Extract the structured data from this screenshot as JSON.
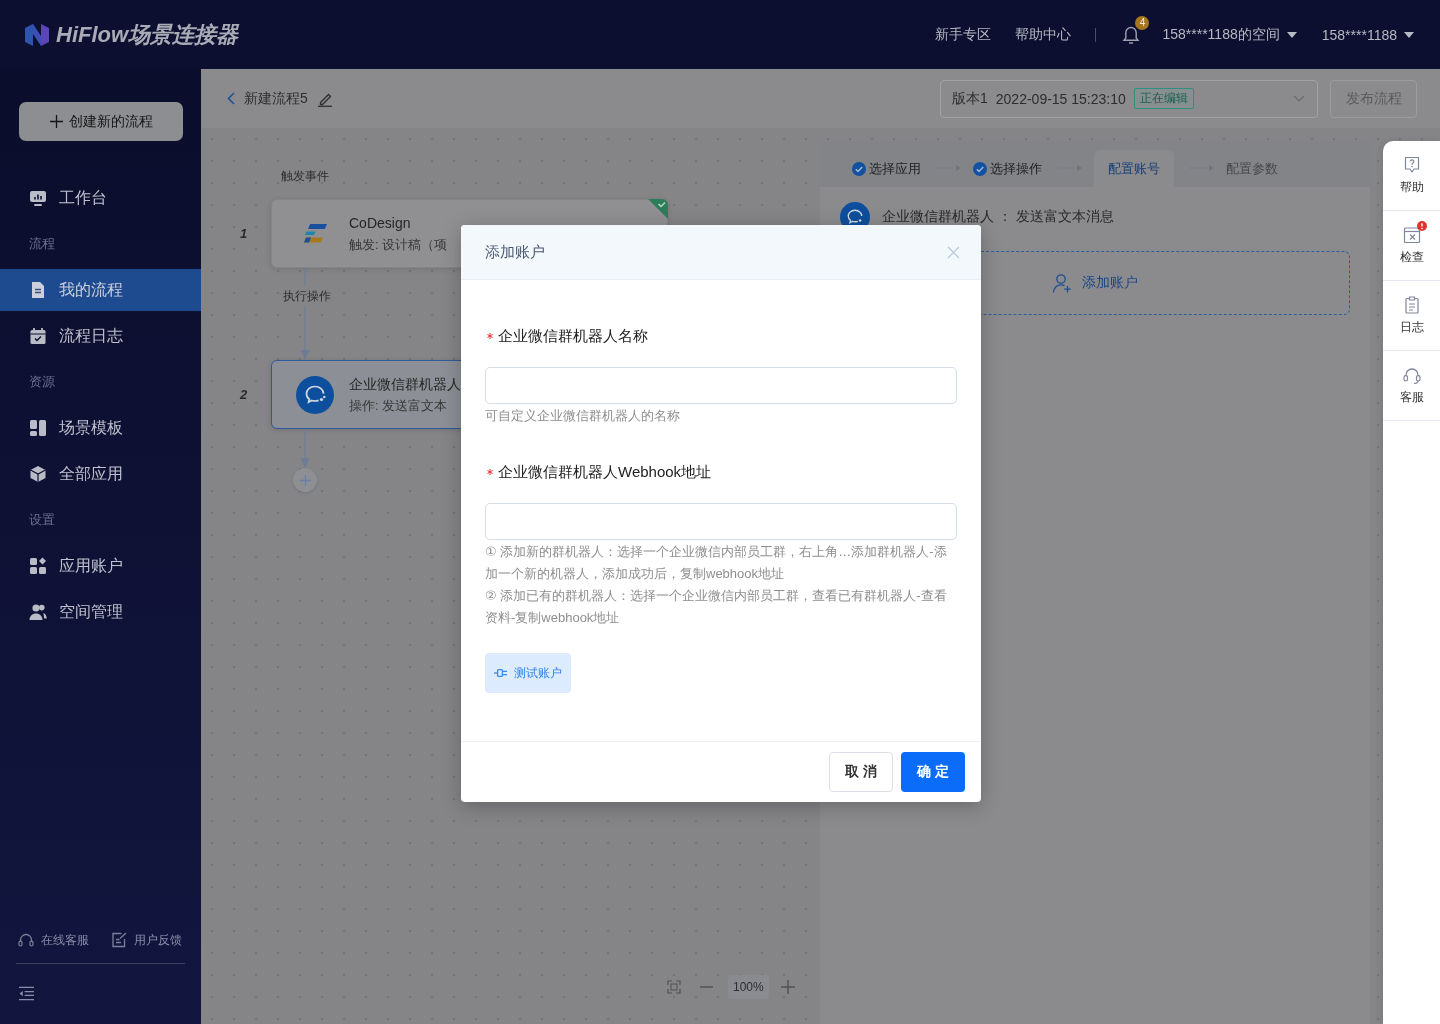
{
  "topbar": {
    "logo": "HiFlow场景连接器",
    "links": [
      "新手专区",
      "帮助中心"
    ],
    "notification_count": "4",
    "space_menu": "158****1188的空间",
    "user_menu": "158****1188"
  },
  "sidebar": {
    "create_button": "创建新的流程",
    "groups": [
      {
        "items": [
          {
            "label": "工作台",
            "selected": false
          }
        ]
      },
      {
        "title": "流程",
        "items": [
          {
            "label": "我的流程",
            "selected": true
          },
          {
            "label": "流程日志",
            "selected": false
          }
        ]
      },
      {
        "title": "资源",
        "items": [
          {
            "label": "场景模板",
            "selected": false
          },
          {
            "label": "全部应用",
            "selected": false
          }
        ]
      },
      {
        "title": "设置",
        "items": [
          {
            "label": "应用账户",
            "selected": false
          },
          {
            "label": "空间管理",
            "selected": false
          }
        ]
      }
    ],
    "footer_links": [
      "在线客服",
      "用户反馈"
    ]
  },
  "page_header": {
    "title": "新建流程5",
    "version": {
      "name": "版本1",
      "time": "2022-09-15 15:23:10",
      "tag": "正在编辑"
    },
    "publish_button": {
      "label": "发布流程",
      "disabled": true
    }
  },
  "canvas": {
    "steps": [
      {
        "number": "1",
        "label": "触发事件",
        "app": "CoDesign",
        "detail": "触发: 设计稿（项",
        "selected": false,
        "complete": true
      },
      {
        "number": "2",
        "label": "执行操作",
        "app": "企业微信群机器人",
        "detail": "操作: 发送富文本",
        "selected": true,
        "complete": false
      }
    ],
    "zoom_level": "100%"
  },
  "config_panel": {
    "steps": [
      {
        "label": "选择应用",
        "done": true,
        "selected": false
      },
      {
        "label": "选择操作",
        "done": true,
        "selected": false
      },
      {
        "label": "配置账号",
        "done": false,
        "selected": true
      },
      {
        "label": "配置参数",
        "done": false,
        "selected": false
      }
    ],
    "title": "企业微信群机器人 ： 发送富文本消息",
    "add_account": "添加账户"
  },
  "side_tools": [
    {
      "label": "帮助",
      "alert": false
    },
    {
      "label": "检查",
      "alert": true
    },
    {
      "label": "日志",
      "alert": false
    },
    {
      "label": "客服",
      "alert": false
    }
  ],
  "dialog": {
    "title": "添加账户",
    "fields": [
      {
        "label": "企业微信群机器人名称",
        "required": true,
        "help": [
          "可自定义企业微信群机器人的名称"
        ]
      },
      {
        "label": "企业微信群机器人Webhook地址",
        "required": true,
        "help": [
          "① 添加新的群机器人：选择一个企业微信内部员工群，右上角…添加群机器人-添加一个新的机器人，添加成功后，复制webhook地址",
          "② 添加已有的群机器人：选择一个企业微信内部员工群，查看已有群机器人-查看资料-复制webhook地址"
        ]
      }
    ],
    "test_button": "测试账户",
    "buttons": [
      {
        "label": "取 消",
        "kind": "secondary"
      },
      {
        "label": "确 定",
        "kind": "primary"
      }
    ]
  }
}
